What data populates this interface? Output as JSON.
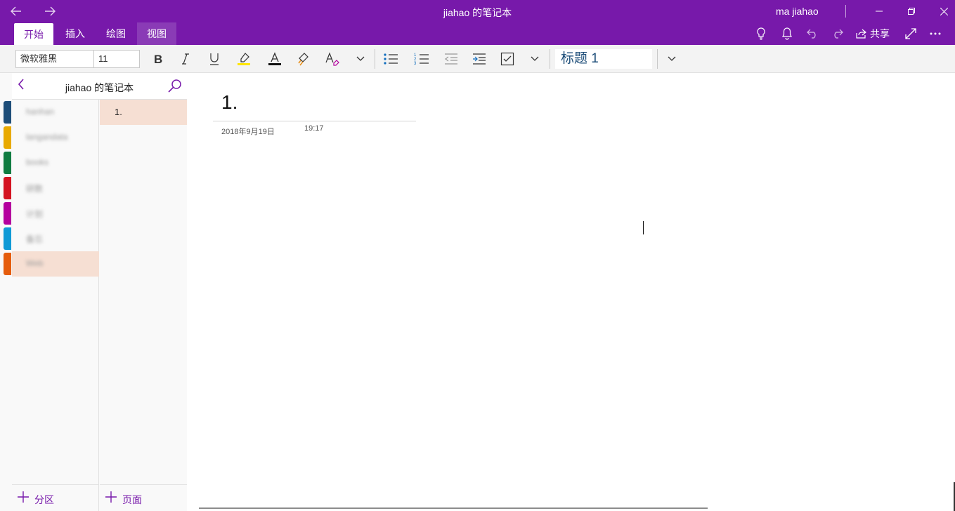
{
  "window": {
    "title": "jiahao 的笔记本",
    "user": "ma jiahao"
  },
  "ribbon": {
    "tabs": [
      "开始",
      "插入",
      "绘图",
      "视图"
    ],
    "share_label": "共享"
  },
  "toolbar": {
    "font_name": "微软雅黑",
    "font_size": "11",
    "style": "标题 1",
    "colors": {
      "highlight": "#ffe600",
      "font_color": "#111111",
      "accent": "#7719aa"
    }
  },
  "notebook": {
    "name": "jiahao 的笔记本",
    "sections": [
      {
        "label": "hanhan",
        "color": "#1e4e79"
      },
      {
        "label": "langandata",
        "color": "#e8a900"
      },
      {
        "label": "books",
        "color": "#107c41"
      },
      {
        "label": "研数",
        "color": "#d41321"
      },
      {
        "label": "计划",
        "color": "#b4009e"
      },
      {
        "label": "备忘",
        "color": "#0f9ad6"
      },
      {
        "label": "Web",
        "color": "#e55d0d"
      }
    ],
    "selected_section_index": 6,
    "pages": [
      {
        "label": "1."
      }
    ],
    "add_section_label": "分区",
    "add_page_label": "页面"
  },
  "page": {
    "title": "1.",
    "date": "2018年9月19日",
    "time": "19:17"
  }
}
